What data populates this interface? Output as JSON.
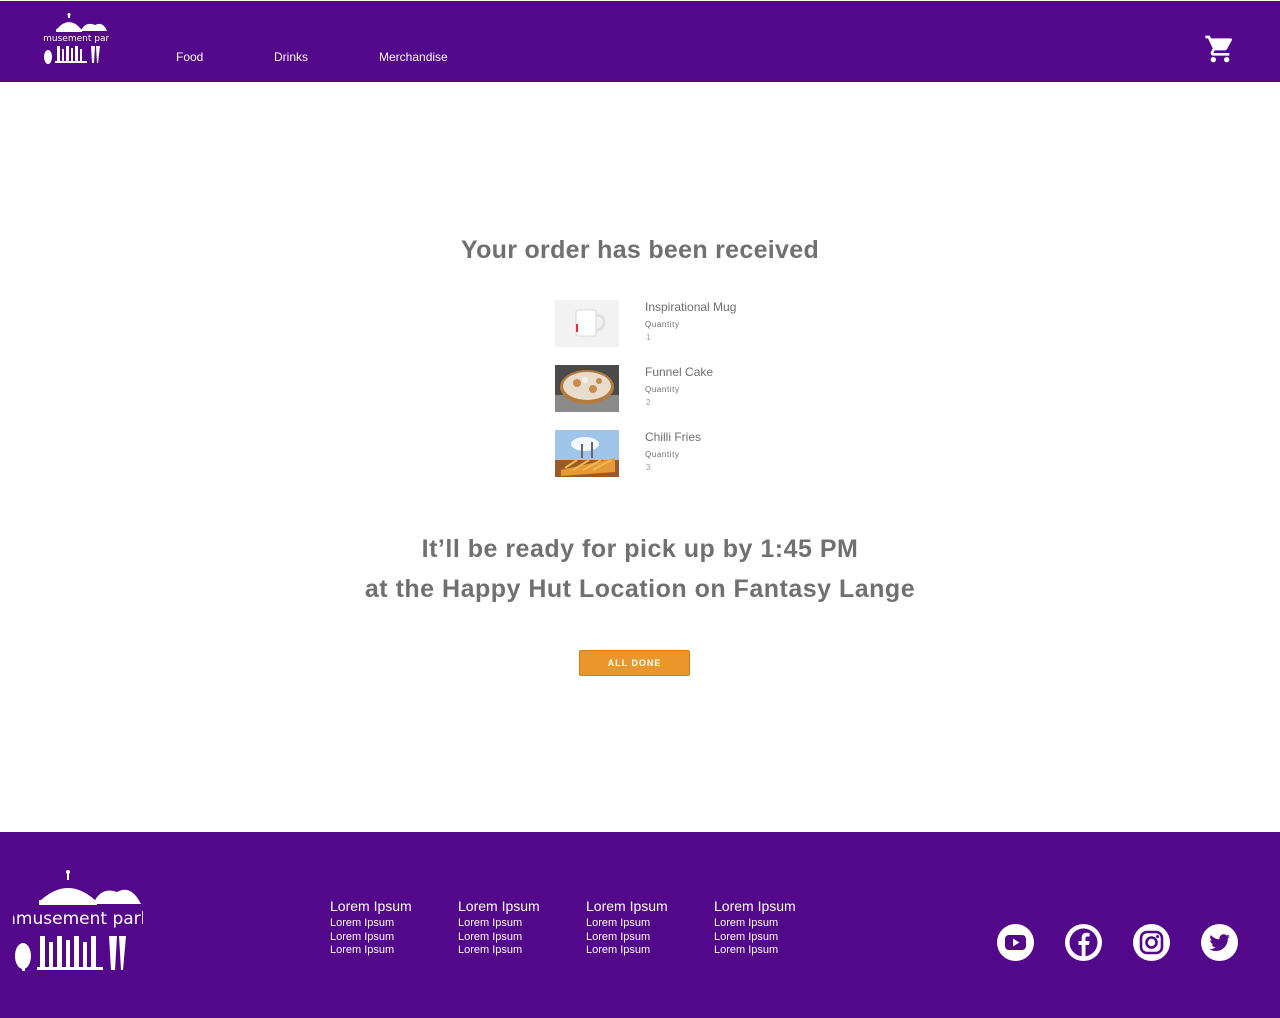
{
  "header": {
    "logo_text": "amusement park",
    "nav": [
      {
        "label": "Food"
      },
      {
        "label": "Drinks"
      },
      {
        "label": "Merchandise"
      }
    ]
  },
  "main": {
    "title": "Your order has been received",
    "items": [
      {
        "name": "Inspirational Mug",
        "qty_label": "Quantity",
        "qty": "1",
        "image": "mug"
      },
      {
        "name": "Funnel Cake",
        "qty_label": "Quantity",
        "qty": "2",
        "image": "funnel-cake"
      },
      {
        "name": "Chilli Fries",
        "qty_label": "Quantity",
        "qty": "3",
        "image": "chilli-fries"
      }
    ],
    "ready_line_1": "It’ll be ready for pick up by 1:45 PM",
    "ready_line_2": "at the Happy Hut Location on Fantasy Lange",
    "done_button": "ALL DONE"
  },
  "footer": {
    "logo_text": "amusement park",
    "columns": [
      {
        "heading": "Lorem Ipsum",
        "links": [
          "Lorem Ipsum",
          "Lorem Ipsum",
          "Lorem Ipsum"
        ]
      },
      {
        "heading": "Lorem Ipsum",
        "links": [
          "Lorem Ipsum",
          "Lorem Ipsum",
          "Lorem Ipsum"
        ]
      },
      {
        "heading": "Lorem Ipsum",
        "links": [
          "Lorem Ipsum",
          "Lorem Ipsum",
          "Lorem Ipsum"
        ]
      },
      {
        "heading": "Lorem Ipsum",
        "links": [
          "Lorem Ipsum",
          "Lorem Ipsum",
          "Lorem Ipsum"
        ]
      }
    ],
    "social": [
      "youtube-icon",
      "facebook-icon",
      "instagram-icon",
      "twitter-icon"
    ]
  },
  "colors": {
    "brand_purple": "#53078a",
    "accent_orange": "#e9962a",
    "text_gray": "#707070"
  }
}
